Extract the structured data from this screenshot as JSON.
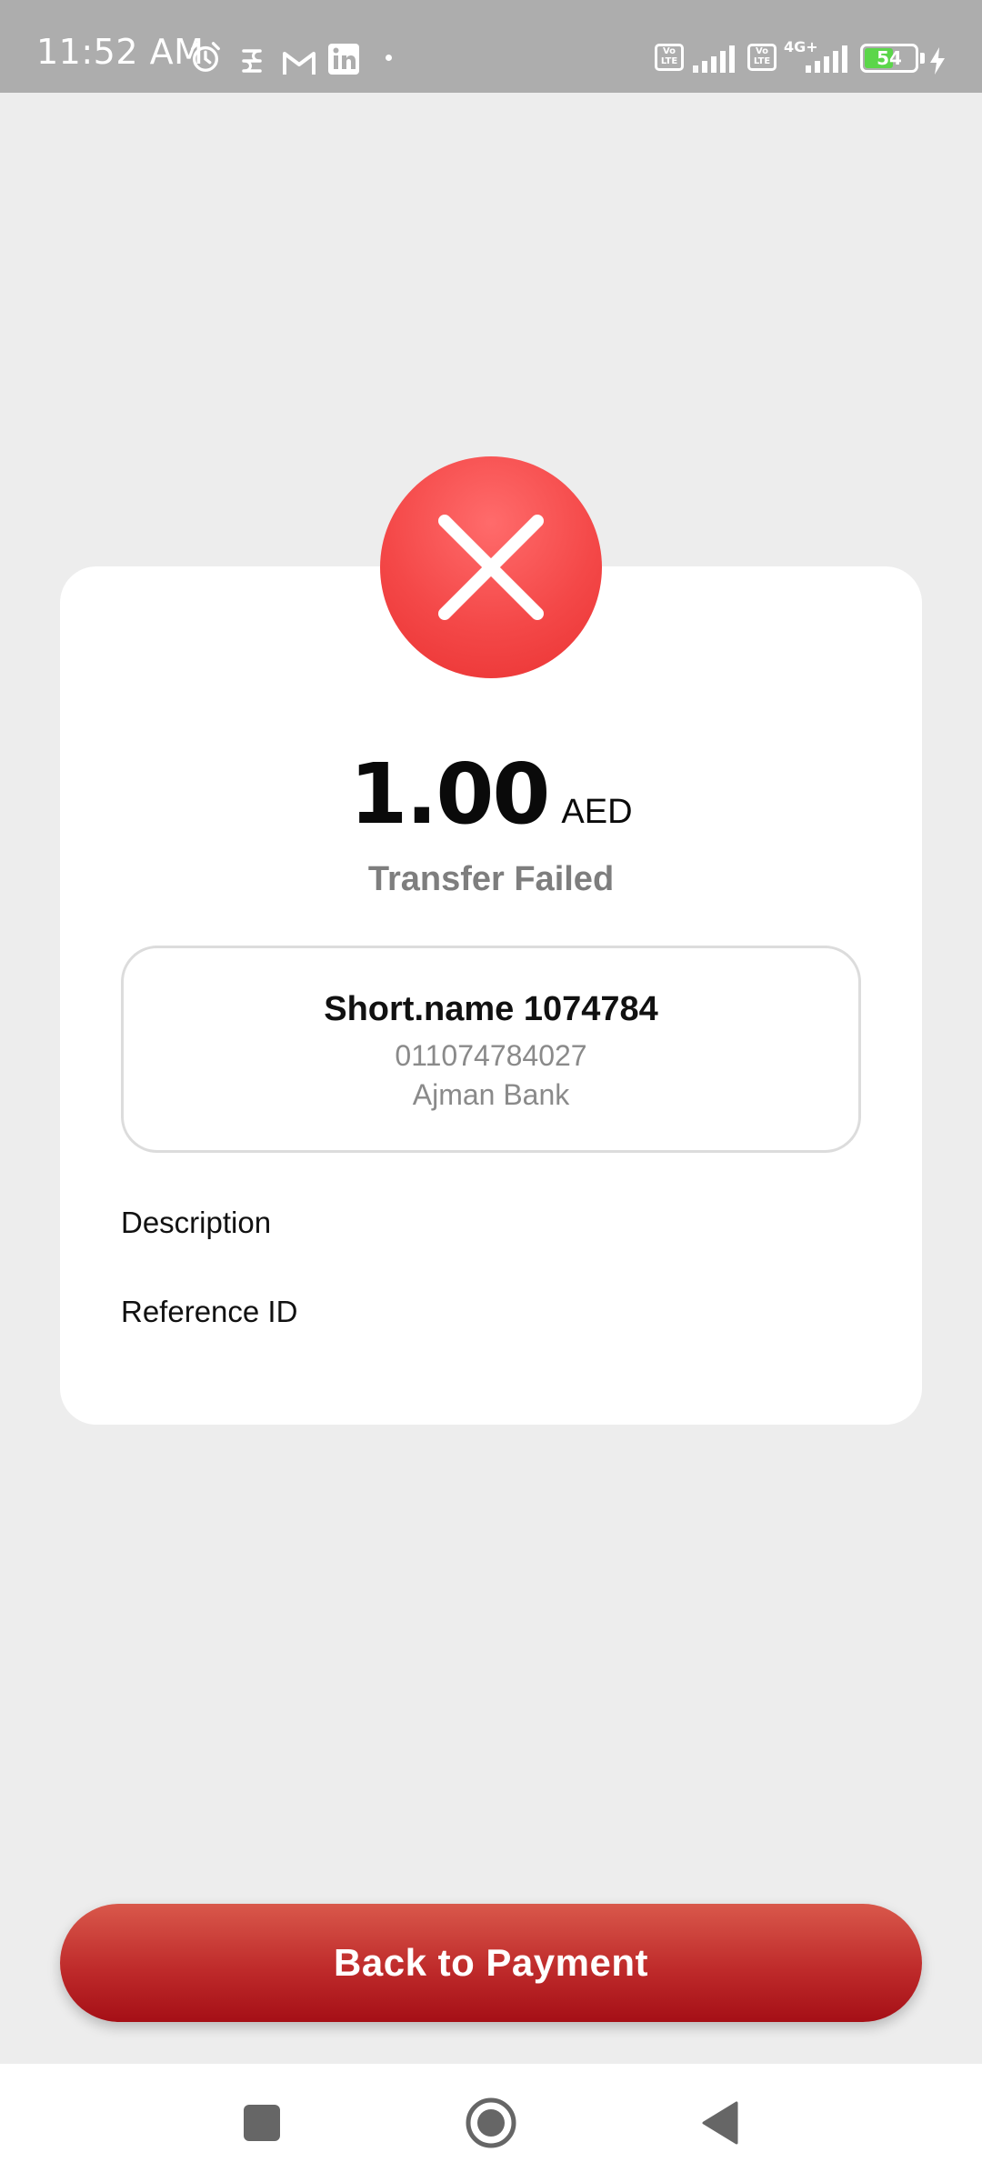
{
  "status_bar": {
    "time": "11:52 AM",
    "icons": [
      "alarm-icon",
      "hotspot-icon",
      "gmail-icon",
      "linkedin-icon",
      "dot-icon",
      "volte-icon",
      "signal-icon",
      "volte-icon",
      "4g-signal-icon",
      "battery-icon",
      "charging-icon"
    ],
    "volte_label": "Vo LTE",
    "network_type": "4G+",
    "battery_level": "54",
    "battery_percent": 54
  },
  "result": {
    "status_icon": "close-icon",
    "status_color": "#f44848",
    "amount": "1.00",
    "currency": "AED",
    "status_text": "Transfer Failed"
  },
  "beneficiary": {
    "name": "Short.name 1074784",
    "account": "011074784027",
    "bank": "Ajman Bank"
  },
  "fields": {
    "description_label": "Description",
    "reference_label": "Reference ID"
  },
  "actions": {
    "back_button_label": "Back to Payment",
    "button_color": "#bf2b2b"
  },
  "nav_bar": {
    "buttons": [
      "recents-icon",
      "home-icon",
      "back-icon"
    ]
  }
}
